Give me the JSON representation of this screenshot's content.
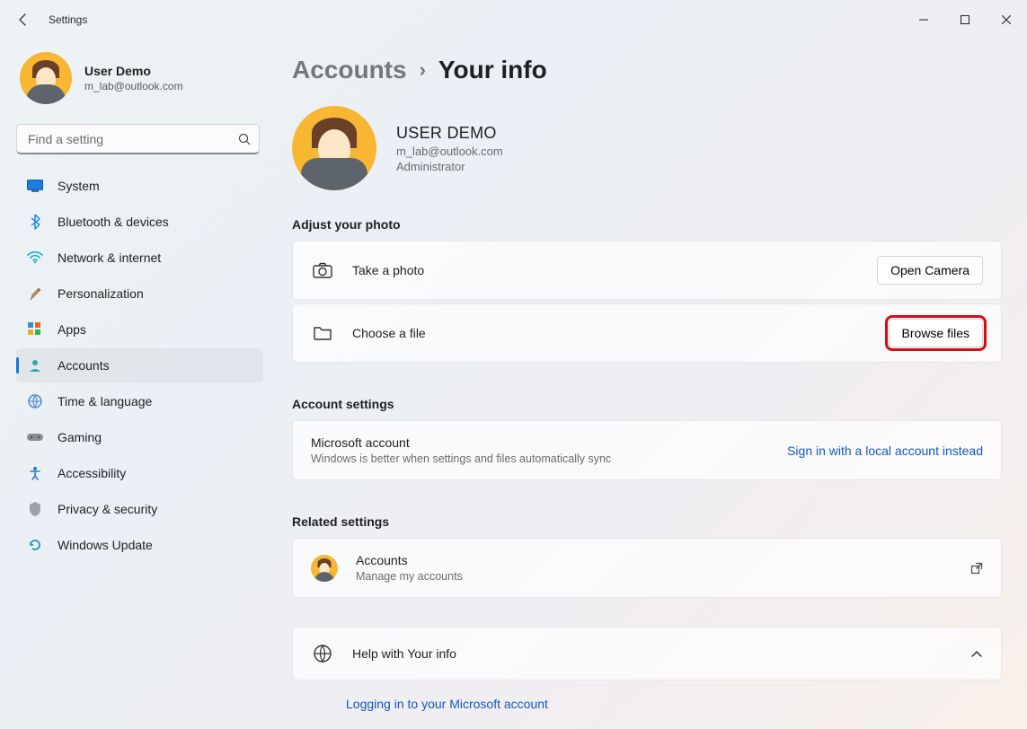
{
  "window": {
    "title": "Settings"
  },
  "sidebar": {
    "profile": {
      "name": "User Demo",
      "email": "m_lab@outlook.com"
    },
    "search_placeholder": "Find a setting",
    "items": [
      {
        "label": "System"
      },
      {
        "label": "Bluetooth & devices"
      },
      {
        "label": "Network & internet"
      },
      {
        "label": "Personalization"
      },
      {
        "label": "Apps"
      },
      {
        "label": "Accounts"
      },
      {
        "label": "Time & language"
      },
      {
        "label": "Gaming"
      },
      {
        "label": "Accessibility"
      },
      {
        "label": "Privacy & security"
      },
      {
        "label": "Windows Update"
      }
    ]
  },
  "breadcrumb": {
    "root": "Accounts",
    "leaf": "Your info"
  },
  "profile_large": {
    "name": "USER DEMO",
    "email": "m_lab@outlook.com",
    "role": "Administrator"
  },
  "sections": {
    "adjust_photo": {
      "header": "Adjust your photo",
      "take_photo_label": "Take a photo",
      "open_camera_button": "Open Camera",
      "choose_file_label": "Choose a file",
      "browse_files_button": "Browse files"
    },
    "account_settings": {
      "header": "Account settings",
      "ms_account_title": "Microsoft account",
      "ms_account_sub": "Windows is better when settings and files automatically sync",
      "local_link": "Sign in with a local account instead"
    },
    "related": {
      "header": "Related settings",
      "accounts_title": "Accounts",
      "accounts_sub": "Manage my accounts"
    },
    "help": {
      "title": "Help with Your info",
      "link1": "Logging in to your Microsoft account"
    }
  }
}
